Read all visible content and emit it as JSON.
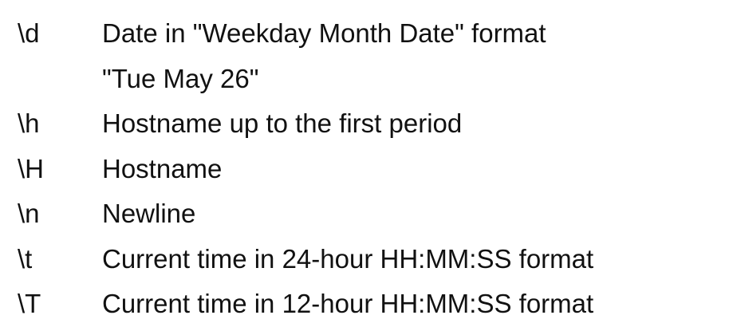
{
  "escapes": [
    {
      "code": "\\d",
      "description": [
        "Date in \"Weekday Month Date\" format",
        "\"Tue May 26\""
      ]
    },
    {
      "code": "\\h",
      "description": [
        "Hostname up to the first period"
      ]
    },
    {
      "code": "\\H",
      "description": [
        "Hostname"
      ]
    },
    {
      "code": "\\n",
      "description": [
        "Newline"
      ]
    },
    {
      "code": "\\t",
      "description": [
        "Current time in 24-hour HH:MM:SS format"
      ]
    },
    {
      "code": "\\T",
      "description": [
        "Current time in 12-hour HH:MM:SS format"
      ]
    }
  ]
}
